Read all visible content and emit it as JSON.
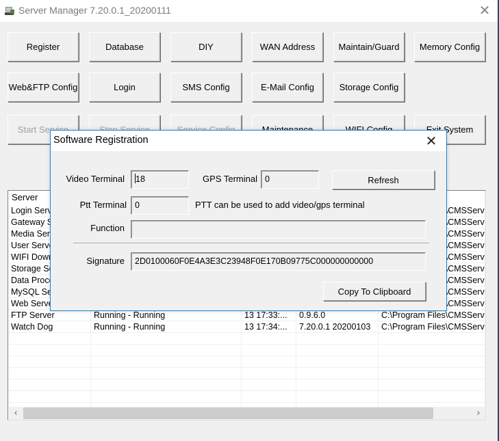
{
  "window": {
    "title": "Server Manager 7.20.0.1_20200111",
    "close_glyph": "✕",
    "app_icon": "server-manager-icon"
  },
  "toolbar": {
    "row1": [
      "Register",
      "Database",
      "DIY",
      "WAN Address",
      "Maintain/Guard",
      "Memory Config"
    ],
    "row2": [
      "Web&FTP Config",
      "Login",
      "SMS Config",
      "E-Mail Config",
      "Storage Config"
    ],
    "row3": [
      {
        "label": "Start Service",
        "enabled": false
      },
      {
        "label": "Stop Service",
        "enabled": false
      },
      {
        "label": "Service Config",
        "enabled": false
      },
      {
        "label": "Maintenance",
        "enabled": true
      },
      {
        "label": "WIFI Config",
        "enabled": true
      },
      {
        "label": "Exit System",
        "enabled": true
      }
    ]
  },
  "server_list": {
    "columns": [
      "Server",
      "",
      "",
      "",
      ""
    ],
    "rows": [
      [
        "Login Server",
        "",
        "",
        "",
        "C:\\Program Files\\CMSServer"
      ],
      [
        "Gateway Server",
        "",
        "",
        "",
        "C:\\Program Files\\CMSServer"
      ],
      [
        "Media Server",
        "",
        "",
        "",
        "C:\\Program Files\\CMSServer"
      ],
      [
        "User Server",
        "",
        "",
        "",
        "C:\\Program Files\\CMSServer"
      ],
      [
        "WIFI Download Server",
        "",
        "",
        "",
        "C:\\Program Files\\CMSServer"
      ],
      [
        "Storage Server",
        "",
        "",
        "",
        "C:\\Program Files\\CMSServer"
      ],
      [
        "Data Process Server",
        "",
        "",
        "",
        "C:\\Program Files\\CMSServer"
      ],
      [
        "MySQL Server",
        "",
        "",
        "",
        "C:\\Program Files\\CMSServer"
      ],
      [
        "Web Server",
        "",
        "",
        "",
        "C:\\Program Files\\CMSServer"
      ],
      [
        "FTP Server",
        "Running - Running",
        "13 17:33:...",
        "0.9.6.0",
        "C:\\Program Files\\CMSServer"
      ],
      [
        "Watch Dog",
        "Running - Running",
        "13 17:34:...",
        "7.20.0.1 20200103",
        "C:\\Program Files\\CMSServer"
      ],
      [
        "",
        "",
        "",
        "",
        ""
      ],
      [
        "",
        "",
        "",
        "",
        ""
      ],
      [
        "",
        "",
        "",
        "",
        ""
      ],
      [
        "",
        "",
        "",
        "",
        ""
      ],
      [
        "",
        "",
        "",
        "",
        ""
      ],
      [
        "",
        "",
        "",
        "",
        ""
      ],
      [
        "",
        "",
        "",
        "",
        ""
      ]
    ],
    "scroll_left_glyph": "‹",
    "scroll_right_glyph": "›"
  },
  "dialog": {
    "title": "Software Registration",
    "close_glyph": "✕",
    "video_terminal_label": "Video Terminal",
    "video_terminal_value": "18",
    "gps_terminal_label": "GPS Terminal",
    "gps_terminal_value": "0",
    "refresh_label": "Refresh",
    "ptt_terminal_label": "Ptt Terminal",
    "ptt_terminal_value": "0",
    "ptt_note": "PTT can be used to add video/gps terminal",
    "function_label": "Function",
    "function_value": "",
    "signature_label": "Signature",
    "signature_value": "2D0100060F0E4A3E3C23948F0E170B09775C000000000000",
    "copy_label": "Copy To Clipboard"
  }
}
